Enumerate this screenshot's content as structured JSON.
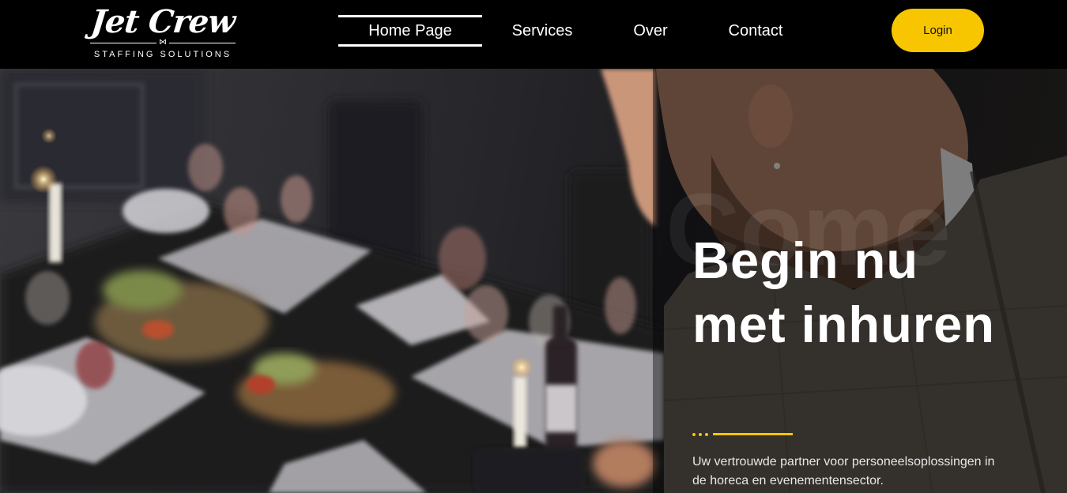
{
  "brand": {
    "name": "Jet Crew",
    "tagline": "STAFFING SOLUTIONS",
    "icon": "bowtie-icon"
  },
  "nav": {
    "items": [
      {
        "label": "Home Page",
        "active": true
      },
      {
        "label": "Services",
        "active": false
      },
      {
        "label": "Over",
        "active": false
      },
      {
        "label": "Contact",
        "active": false
      }
    ],
    "login_label": "Login"
  },
  "hero": {
    "title": "Begin nu met inhuren",
    "description": "Uw vertrouwde partner voor personeelsoplossingen in de horeca en evenementensector."
  },
  "colors": {
    "accent": "#f7c600",
    "header_bg": "#000000",
    "text": "#ffffff"
  }
}
